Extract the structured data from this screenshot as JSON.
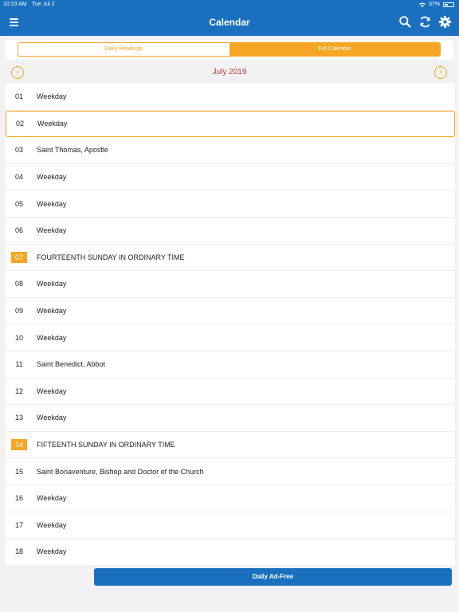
{
  "status_bar": {
    "time": "10:23 AM",
    "date": "Tue Jul 2",
    "battery": "37%"
  },
  "nav": {
    "title": "Calendar"
  },
  "segments": {
    "daily": "Daily Readings",
    "full": "Full Calendar",
    "active": "full"
  },
  "month": {
    "label": "July 2019",
    "prev_icon": "‹",
    "next_icon": "›"
  },
  "colors": {
    "primary": "#1a6fbf",
    "accent": "#f5a623",
    "month_text": "#c0392b"
  },
  "days": [
    {
      "num": "01",
      "name": "Weekday"
    },
    {
      "num": "02",
      "name": "Weekday",
      "selected": true
    },
    {
      "num": "03",
      "name": "Saint Thomas, Apostle"
    },
    {
      "num": "04",
      "name": "Weekday"
    },
    {
      "num": "05",
      "name": "Weekday"
    },
    {
      "num": "06",
      "name": "Weekday"
    },
    {
      "num": "07",
      "name": "FOURTEENTH SUNDAY IN ORDINARY TIME",
      "sunday": true
    },
    {
      "num": "08",
      "name": "Weekday"
    },
    {
      "num": "09",
      "name": "Weekday"
    },
    {
      "num": "10",
      "name": "Weekday"
    },
    {
      "num": "11",
      "name": "Saint Benedict, Abbot"
    },
    {
      "num": "12",
      "name": "Weekday"
    },
    {
      "num": "13",
      "name": "Weekday"
    },
    {
      "num": "14",
      "name": "FIFTEENTH SUNDAY IN ORDINARY TIME",
      "sunday": true
    },
    {
      "num": "15",
      "name": "Saint Bonaventure, Bishop and Doctor of the Church"
    },
    {
      "num": "16",
      "name": "Weekday"
    },
    {
      "num": "17",
      "name": "Weekday"
    },
    {
      "num": "18",
      "name": "Weekday"
    }
  ],
  "ad_button": {
    "label": "Daily Ad-Free"
  }
}
